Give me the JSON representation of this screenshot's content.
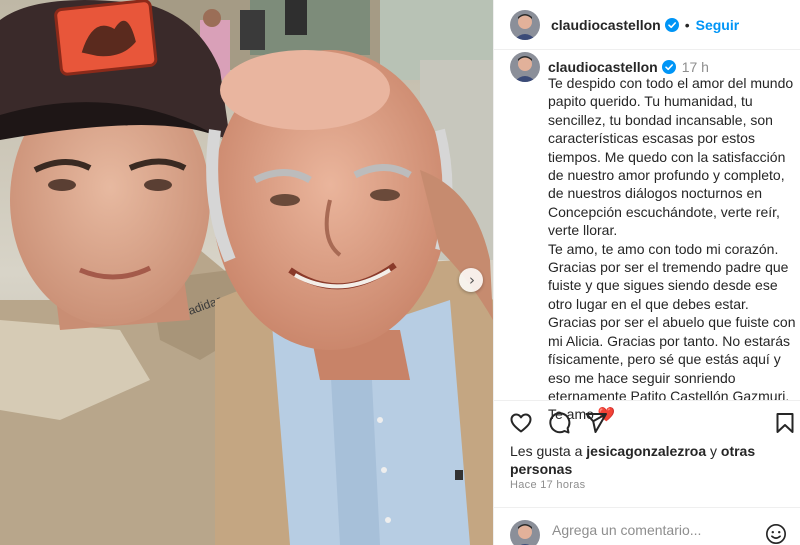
{
  "post": {
    "username": "claudiocastellon",
    "follow_label": "Seguir",
    "separator": "•",
    "time_ago": "17 h",
    "caption": "Te despido con todo el amor del mundo papito querido. Tu humanidad, tu sencillez, tu bondad incansable, son características escasas por estos tiempos. Me quedo con la satisfacción de nuestro amor profundo y completo, de nuestros diálogos nocturnos en Concepción escuchándote, verte reír, verte llorar.\nTe amo, te amo con todo mi corazón. Gracias por ser el tremendo padre que fuiste y que sigues siendo desde ese otro lugar en el que debes estar. Gracias por ser el abuelo que fuiste con mi Alicia. Gracias por tanto. No estarás físicamente, pero sé que estás aquí y eso me hace seguir sonriendo eternamente Patito Castellón Gazmuri. Te amo",
    "caption_emoji": "❤️",
    "likes_prefix": "Les gusta a ",
    "likes_user": "jesicagonzalezroa",
    "likes_middle": " y ",
    "likes_others": "otras personas",
    "posted_ago": "Hace 17 horas"
  },
  "comment": {
    "placeholder": "Agrega un comentario..."
  },
  "icons": {
    "verified": "verified-badge-icon",
    "like": "heart-icon",
    "comment": "comment-icon",
    "share": "send-icon",
    "save": "bookmark-icon",
    "emoji": "emoji-icon",
    "next": "chevron-right-icon"
  },
  "colors": {
    "link_blue": "#0095f6",
    "text": "#262626",
    "muted": "#8e8e8e",
    "verified": "#0095f6",
    "heart": "#e0245e"
  }
}
